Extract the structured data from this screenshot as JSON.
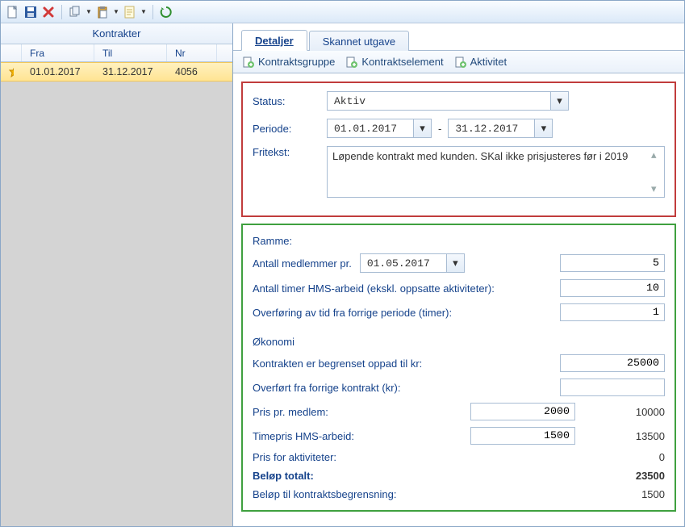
{
  "toolbar": {
    "icons": [
      "new",
      "save",
      "delete",
      "copy",
      "paste",
      "note",
      "refresh"
    ]
  },
  "leftpane": {
    "title": "Kontrakter",
    "columns": {
      "fra": "Fra",
      "til": "Til",
      "nr": "Nr"
    },
    "rows": [
      {
        "fra": "01.01.2017",
        "til": "31.12.2017",
        "nr": "4056",
        "starred": true,
        "selected": true
      }
    ]
  },
  "tabs": [
    {
      "id": "detaljer",
      "label": "Detaljer",
      "active": true
    },
    {
      "id": "skannet",
      "label": "Skannet utgave",
      "active": false
    }
  ],
  "ribbon": {
    "kontraktsgruppe": "Kontraktsgruppe",
    "kontraktselement": "Kontraktselement",
    "aktivitet": "Aktivitet"
  },
  "status_panel": {
    "labels": {
      "status": "Status:",
      "periode": "Periode:",
      "fritekst": "Fritekst:",
      "period_sep": "-"
    },
    "status_value": "Aktiv",
    "periode_fra": "01.01.2017",
    "periode_til": "31.12.2017",
    "fritekst": "Løpende kontrakt med kunden. SKal ikke prisjusteres før i 2019"
  },
  "ramme": {
    "heading": "Ramme:",
    "antall_medlemmer_label": "Antall medlemmer pr.",
    "antall_medlemmer_date": "01.05.2017",
    "antall_medlemmer_value": "5",
    "hms_timer_label": "Antall timer HMS-arbeid (ekskl. oppsatte aktiviteter):",
    "hms_timer_value": "10",
    "overforing_label": "Overføring av tid fra forrige periode (timer):",
    "overforing_value": "1"
  },
  "okonomi": {
    "heading": "Økonomi",
    "begrenset_label": "Kontrakten er begrenset oppad til kr:",
    "begrenset_value": "25000",
    "overfort_label": "Overført fra forrige kontrakt (kr):",
    "overfort_value": "",
    "pris_medlem_label": "Pris pr. medlem:",
    "pris_medlem_input": "2000",
    "pris_medlem_total": "10000",
    "timepris_label": "Timepris HMS-arbeid:",
    "timepris_input": "1500",
    "timepris_total": "13500",
    "aktiviteter_label": "Pris for aktiviteter:",
    "aktiviteter_total": "0",
    "totalt_label": "Beløp totalt:",
    "totalt_value": "23500",
    "tilbegrensning_label": "Beløp til kontraktsbegrensning:",
    "tilbegrensning_value": "1500"
  }
}
